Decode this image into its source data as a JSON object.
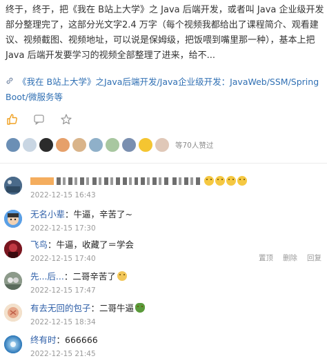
{
  "article": {
    "paragraph": "终于，终于，把《我在 B站上大学》之 Java 后端开发，或者叫 Java 企业级开发部分整理完了，这部分光文字2.4 万字（每个视频我都给出了课程简介、观看建议、视频截图、视频地址，可以说是保姆级，把饭喂到嘴里那一种），基本上把 Java 后端开发要学习的视频全部整理了进来，给不...",
    "link_text": "《我在 B站上大学》之Java后端开发/Java企业级开发：JavaWeb/SSM/Spring Boot/微服务等"
  },
  "actions": {
    "like_icon": "thumbs-up-icon",
    "comment_icon": "comment-bubble-icon",
    "favorite_icon": "star-icon",
    "like_color": "#f0a020"
  },
  "likes": {
    "count_text": "等70人赞过",
    "avatars": [
      "#6b8fb5",
      "#c9d6e3",
      "#2b2b2b",
      "#e6a06a",
      "#d9b48a",
      "#8fb0c9",
      "#a8c7a0",
      "#7a8fb0",
      "#f4c531",
      "#e0c8b8"
    ]
  },
  "comments": [
    {
      "name": "",
      "text": "",
      "time": "2022-12-15 16:43",
      "avatar_color": "#4a6a8a",
      "obscured": true
    },
    {
      "name": "无名小辈",
      "text": "：牛逼，辛苦了~",
      "time": "2022-12-15 17:30",
      "avatar_color": "#3a7bd5"
    },
    {
      "name": "飞鸟",
      "text": "：牛逼，收藏了＝学会",
      "time": "2022-12-15 17:40",
      "avatar_color": "#8a1f2a",
      "ops": [
        "置顶",
        "删除",
        "回复"
      ]
    },
    {
      "name": "先...后...",
      "text": "：二哥辛苦了",
      "time": "2022-12-15 17:47",
      "avatar_color": "#6e7f70"
    },
    {
      "name": "有去无回的包子",
      "text": "：二哥牛逼",
      "time": "2022-12-15 18:34",
      "avatar_color": "#e8c9a8"
    },
    {
      "name": "终有时",
      "text": "：666666",
      "time": "2022-12-15 21:45",
      "avatar_color": "#1b7fd1"
    }
  ]
}
